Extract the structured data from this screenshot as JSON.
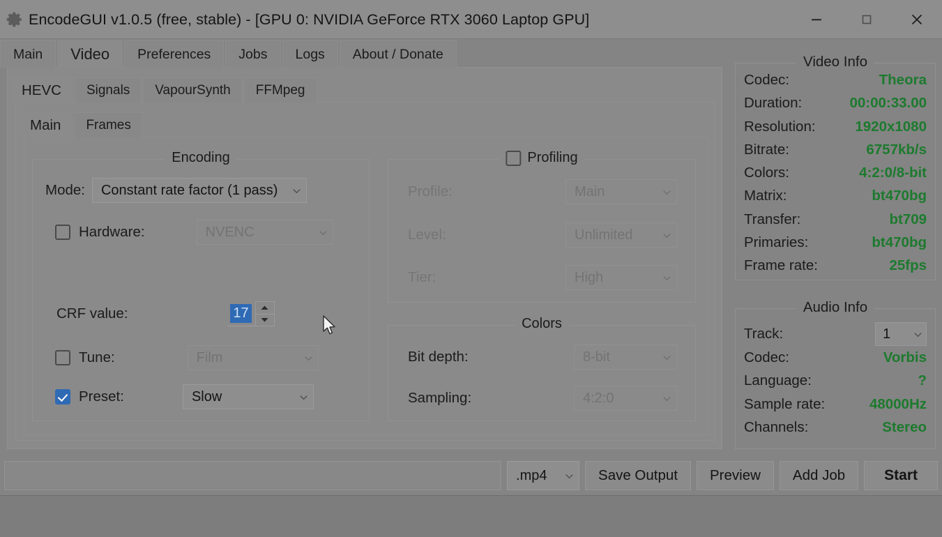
{
  "window": {
    "icon": "gear-icon",
    "title": "EncodeGUI v1.0.5 (free, stable) - [GPU 0: NVIDIA GeForce RTX 3060 Laptop GPU]",
    "controls": {
      "minimize": "minimize-icon",
      "maximize": "maximize-icon",
      "close": "close-icon"
    }
  },
  "tabs_level1": [
    {
      "label": "Main",
      "selected": false
    },
    {
      "label": "Video",
      "selected": true
    },
    {
      "label": "Preferences",
      "selected": false
    },
    {
      "label": "Jobs",
      "selected": false
    },
    {
      "label": "Logs",
      "selected": false
    },
    {
      "label": "About / Donate",
      "selected": false
    }
  ],
  "tabs_level2": [
    {
      "label": "HEVC",
      "selected": true
    },
    {
      "label": "Signals",
      "selected": false
    },
    {
      "label": "VapourSynth",
      "selected": false
    },
    {
      "label": "FFMpeg",
      "selected": false
    }
  ],
  "tabs_level3": [
    {
      "label": "Main",
      "selected": true
    },
    {
      "label": "Frames",
      "selected": false
    }
  ],
  "encoding": {
    "title": "Encoding",
    "mode_label": "Mode:",
    "mode_value": "Constant rate factor (1 pass)",
    "hardware_label": "Hardware:",
    "hardware_checked": false,
    "hardware_value": "NVENC",
    "crf_label": "CRF value:",
    "crf_value": "17",
    "tune_label": "Tune:",
    "tune_checked": false,
    "tune_value": "Film",
    "preset_label": "Preset:",
    "preset_checked": true,
    "preset_value": "Slow"
  },
  "profiling": {
    "title": "Profiling",
    "enabled": false,
    "profile_label": "Profile:",
    "profile_value": "Main",
    "level_label": "Level:",
    "level_value": "Unlimited",
    "tier_label": "Tier:",
    "tier_value": "High"
  },
  "colors": {
    "title": "Colors",
    "bit_depth_label": "Bit depth:",
    "bit_depth_value": "8-bit",
    "sampling_label": "Sampling:",
    "sampling_value": "4:2:0"
  },
  "video_info": {
    "title": "Video Info",
    "rows": [
      {
        "key": "Codec:",
        "value": "Theora"
      },
      {
        "key": "Duration:",
        "value": "00:00:33.00"
      },
      {
        "key": "Resolution:",
        "value": "1920x1080"
      },
      {
        "key": "Bitrate:",
        "value": "6757kb/s"
      },
      {
        "key": "Colors:",
        "value": "4:2:0/8-bit"
      },
      {
        "key": "Matrix:",
        "value": "bt470bg"
      },
      {
        "key": "Transfer:",
        "value": "bt709"
      },
      {
        "key": "Primaries:",
        "value": "bt470bg"
      },
      {
        "key": "Frame rate:",
        "value": "25fps"
      }
    ]
  },
  "audio_info": {
    "title": "Audio Info",
    "track_label": "Track:",
    "track_value": "1",
    "rows": [
      {
        "key": "Codec:",
        "value": "Vorbis"
      },
      {
        "key": "Language:",
        "value": "?"
      },
      {
        "key": "Sample rate:",
        "value": "48000Hz"
      },
      {
        "key": "Channels:",
        "value": "Stereo"
      }
    ]
  },
  "bottom_bar": {
    "output_path": "",
    "output_placeholder": "",
    "extension": ".mp4",
    "save_output": "Save Output",
    "preview": "Preview",
    "add_job": "Add Job",
    "start": "Start"
  },
  "theme": {
    "accent": "#2f6ab4",
    "info_value": "#1d7a2e",
    "window_bg": "#848484",
    "panel_bg": "#8a8a8a",
    "disabled_text": "#757575"
  }
}
